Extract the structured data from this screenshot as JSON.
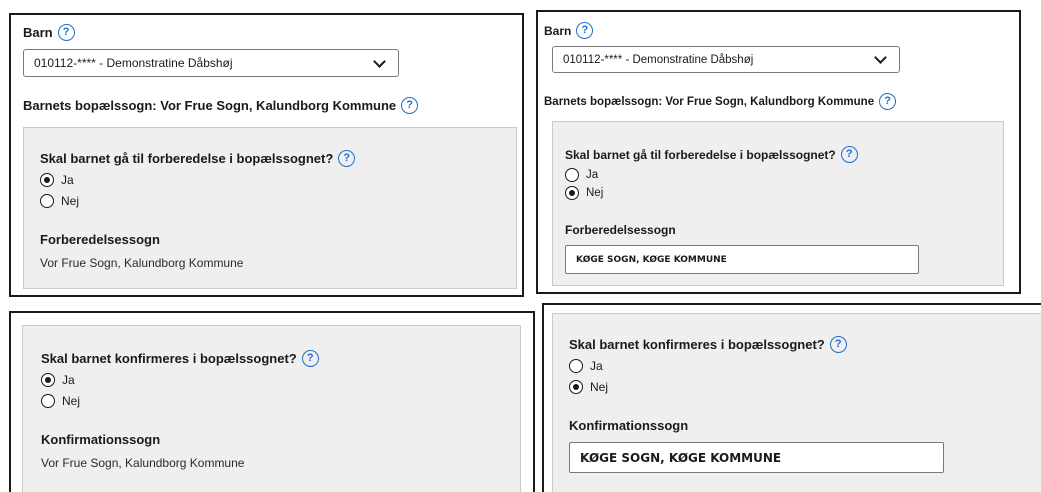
{
  "panel_tl": {
    "barn_label": "Barn",
    "barn_selected": "010112-**** - Demonstratine Dåbshøj",
    "bopael_label": "Barnets bopælssogn: Vor Frue Sogn, Kalundborg Kommune",
    "question": "Skal barnet gå til forberedelse i bopælssognet?",
    "options": [
      "Ja",
      "Nej"
    ],
    "selected": "Ja",
    "result_label": "Forberedelsessogn",
    "result_value": "Vor Frue Sogn, Kalundborg Kommune"
  },
  "panel_tr": {
    "barn_label": "Barn",
    "barn_selected": "010112-**** - Demonstratine Dåbshøj",
    "bopael_label": "Barnets bopælssogn: Vor Frue Sogn, Kalundborg Kommune",
    "question": "Skal barnet gå til forberedelse i bopælssognet?",
    "options": [
      "Ja",
      "Nej"
    ],
    "selected": "Nej",
    "result_label": "Forberedelsessogn",
    "result_value": "KØGE SOGN, KØGE KOMMUNE"
  },
  "panel_bl": {
    "question": "Skal barnet konfirmeres i bopælssognet?",
    "options": [
      "Ja",
      "Nej"
    ],
    "selected": "Ja",
    "result_label": "Konfirmationssogn",
    "result_value": "Vor Frue Sogn, Kalundborg Kommune"
  },
  "panel_br": {
    "question": "Skal barnet konfirmeres i bopælssognet?",
    "options": [
      "Ja",
      "Nej"
    ],
    "selected": "Nej",
    "result_label": "Konfirmationssogn",
    "result_value": "KØGE SOGN, KØGE KOMMUNE"
  },
  "help_icon_glyph": "?",
  "colors": {
    "help_icon": "#1a6fd1",
    "panel_border": "#1a1a1a",
    "greybox": "#efefef"
  }
}
